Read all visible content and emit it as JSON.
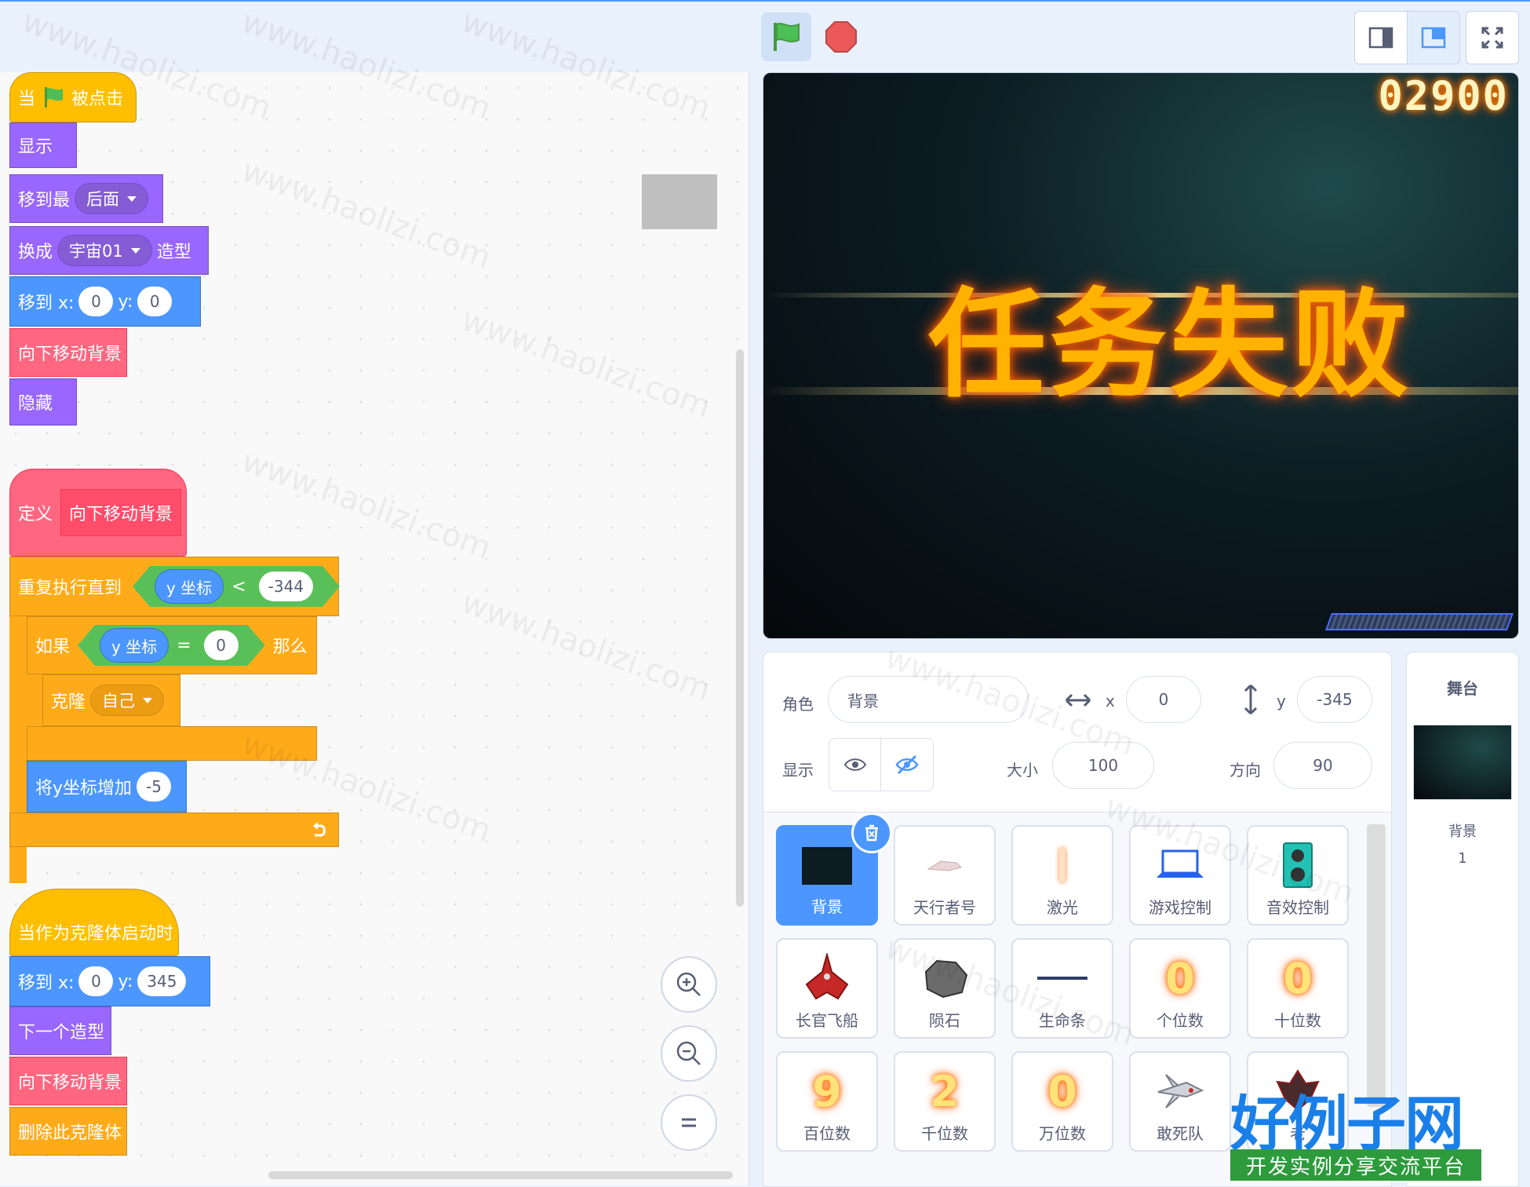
{
  "code": {
    "event_when": "当",
    "event_clicked": "被点击",
    "show": "显示",
    "go_to_front_back": "移到最",
    "layer_value": "后面",
    "switch_costume": "换成",
    "costume_value": "宇宙01",
    "costume_suffix": "造型",
    "goto_x": "移到 x:",
    "goto_y": "y:",
    "x1": "0",
    "y1": "0",
    "move_bg_call": "向下移动背景",
    "hide": "隐藏",
    "define": "定义",
    "define_name": "向下移动背景",
    "repeat_until": "重复执行直到",
    "y_position": "y 坐标",
    "lt": "<",
    "lt_value": "-344",
    "if": "如果",
    "eq": "=",
    "eq_value": "0",
    "then": "那么",
    "clone": "克隆",
    "clone_target": "自己",
    "change_y": "将y坐标增加",
    "change_y_value": "-5",
    "when_clone": "当作为克隆体启动时",
    "x2": "0",
    "y2": "345",
    "next_costume": "下一个造型",
    "move_bg_call2": "向下移动背景",
    "delete_clone": "删除此克隆体"
  },
  "stage": {
    "score": "02900",
    "message": "任务失败"
  },
  "sprite_info": {
    "sprite_label": "角色",
    "sprite_name": "背景",
    "x_label": "x",
    "x_value": "0",
    "y_label": "y",
    "y_value": "-345",
    "show_label": "显示",
    "size_label": "大小",
    "size_value": "100",
    "direction_label": "方向",
    "direction_value": "90"
  },
  "sprites": [
    {
      "name": "背景"
    },
    {
      "name": "天行者号"
    },
    {
      "name": "激光"
    },
    {
      "name": "游戏控制"
    },
    {
      "name": "音效控制"
    },
    {
      "name": "长官飞船"
    },
    {
      "name": "陨石"
    },
    {
      "name": "生命条"
    },
    {
      "name": "个位数",
      "glyph": "0"
    },
    {
      "name": "十位数",
      "glyph": "0"
    },
    {
      "name": "百位数",
      "glyph": "9"
    },
    {
      "name": "千位数",
      "glyph": "2"
    },
    {
      "name": "万位数",
      "glyph": "0"
    },
    {
      "name": "敢死队"
    },
    {
      "name": "老"
    }
  ],
  "stage_panel": {
    "title": "舞台",
    "backdrop_label": "背景",
    "backdrop_count": "1"
  },
  "watermark": "www.haolizi.com",
  "logo": {
    "main": "好例子网",
    "sub": "开发实例分享交流平台"
  },
  "colors": {
    "events": "#ffbf00",
    "looks": "#9966ff",
    "motion": "#4c97ff",
    "custom": "#ff6680",
    "control": "#ffab19",
    "operators": "#59c059"
  }
}
